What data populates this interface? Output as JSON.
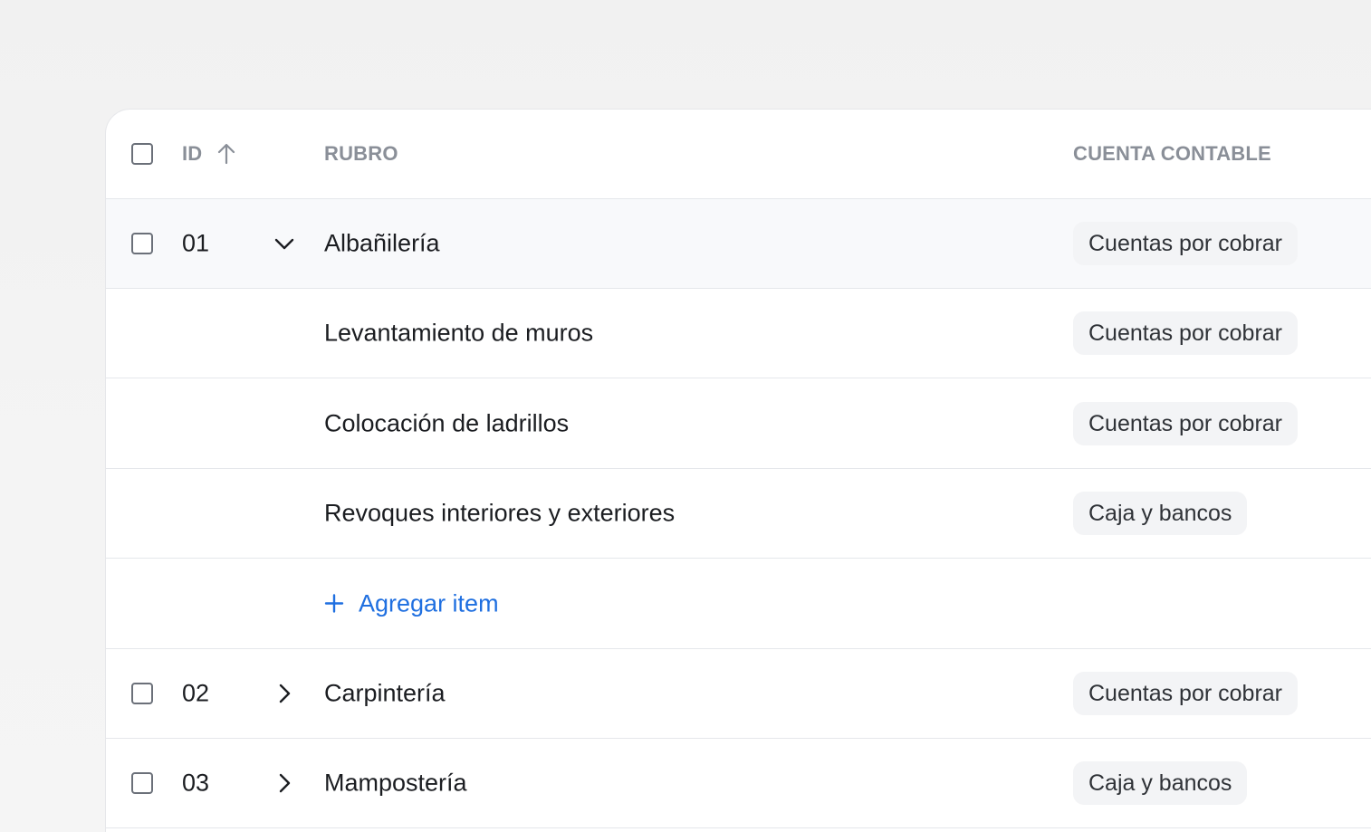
{
  "table": {
    "columns": {
      "id": "ID",
      "rubro": "RUBRO",
      "cuenta": "CUENTA CONTABLE"
    },
    "rows": [
      {
        "id": "01",
        "rubro": "Albañilería",
        "cuenta": "Cuentas por cobrar",
        "expanded": true
      },
      {
        "id": "",
        "rubro": "Levantamiento de muros",
        "cuenta": "Cuentas por cobrar"
      },
      {
        "id": "",
        "rubro": "Colocación de ladrillos",
        "cuenta": "Cuentas por cobrar"
      },
      {
        "id": "",
        "rubro": "Revoques interiores y exteriores",
        "cuenta": "Caja y bancos"
      },
      {
        "id": "02",
        "rubro": "Carpintería",
        "cuenta": "Cuentas por cobrar",
        "expanded": false
      },
      {
        "id": "03",
        "rubro": "Mampostería",
        "cuenta": "Caja y bancos",
        "expanded": false
      }
    ],
    "add_item_label": "Agregar item"
  },
  "colors": {
    "accent": "#1f6fe0",
    "header_text": "#8a8f98",
    "badge_bg": "#f3f4f6",
    "row_highlight": "#f8f9fb"
  },
  "icons": {
    "sort": "arrow-up-icon",
    "expand_open": "chevron-down-icon",
    "expand_closed": "chevron-right-icon",
    "add": "plus-icon"
  }
}
